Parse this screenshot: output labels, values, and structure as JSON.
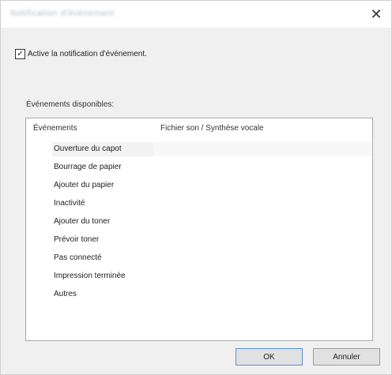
{
  "window": {
    "title": "Notification d'événement",
    "close_glyph": "✕"
  },
  "enable_notification": {
    "checked": true,
    "check_glyph": "✓",
    "label": "Active la notification d'événement."
  },
  "events_group": {
    "label": "Événements disponibles:",
    "columns": [
      "Événements",
      "Fichier son / Synthèse vocale"
    ],
    "items": [
      "Ouverture du capot",
      "Bourrage de papier",
      "Ajouter du papier",
      "Inactivité",
      "Ajouter du toner",
      "Prévoir toner",
      "Pas connecté",
      "Impression terminée",
      "Autres"
    ],
    "selected_index": 0
  },
  "buttons": {
    "ok": "OK",
    "cancel": "Annuler"
  }
}
